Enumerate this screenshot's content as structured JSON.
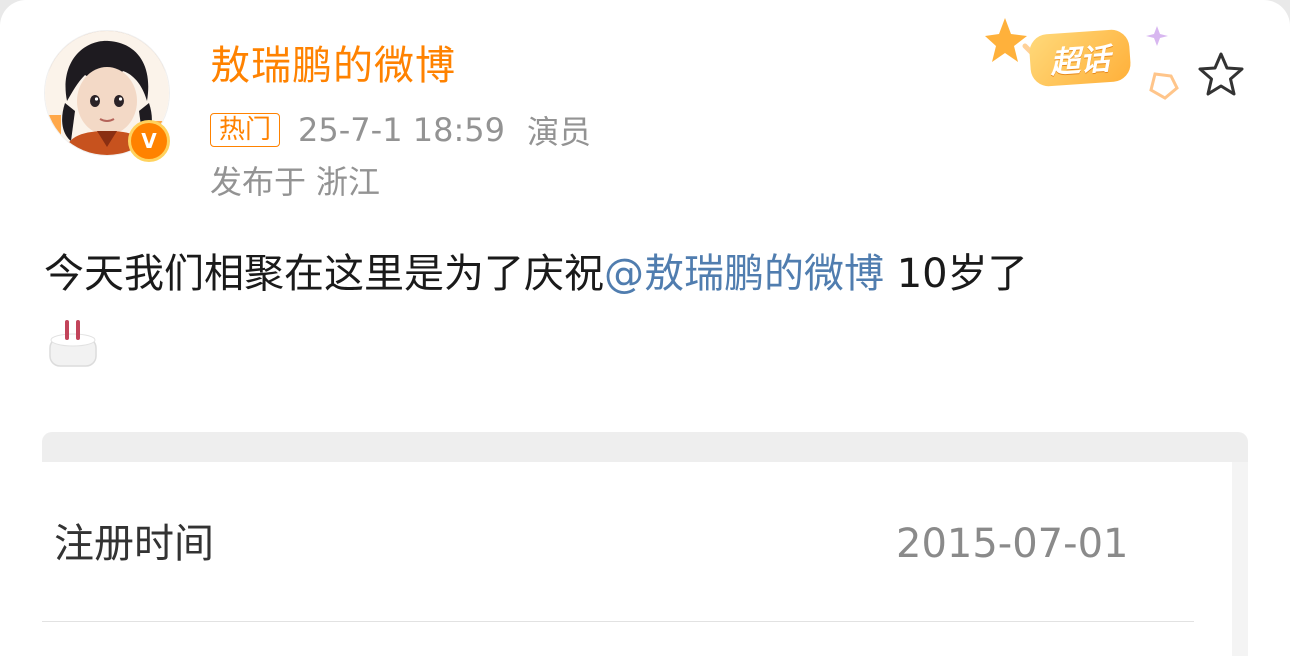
{
  "post": {
    "author": {
      "name": "敖瑞鹏的微博",
      "verified_mark": "V"
    },
    "badge": "热门",
    "time": "25-7-1 18:59",
    "role": "演员",
    "location_prefix": "发布于",
    "location": "浙江",
    "supertopic_label": "超话",
    "text_before": "今天我们相聚在这里是为了庆祝",
    "mention": "@敖瑞鹏的微博",
    "text_after": " 10岁了",
    "emoji_icon": "cake-icon"
  },
  "info": {
    "rows": [
      {
        "label": "注册时间",
        "value": "2015-07-01"
      }
    ]
  },
  "colors": {
    "accent": "#ff8200",
    "mention": "#507daf",
    "meta": "#939393"
  }
}
